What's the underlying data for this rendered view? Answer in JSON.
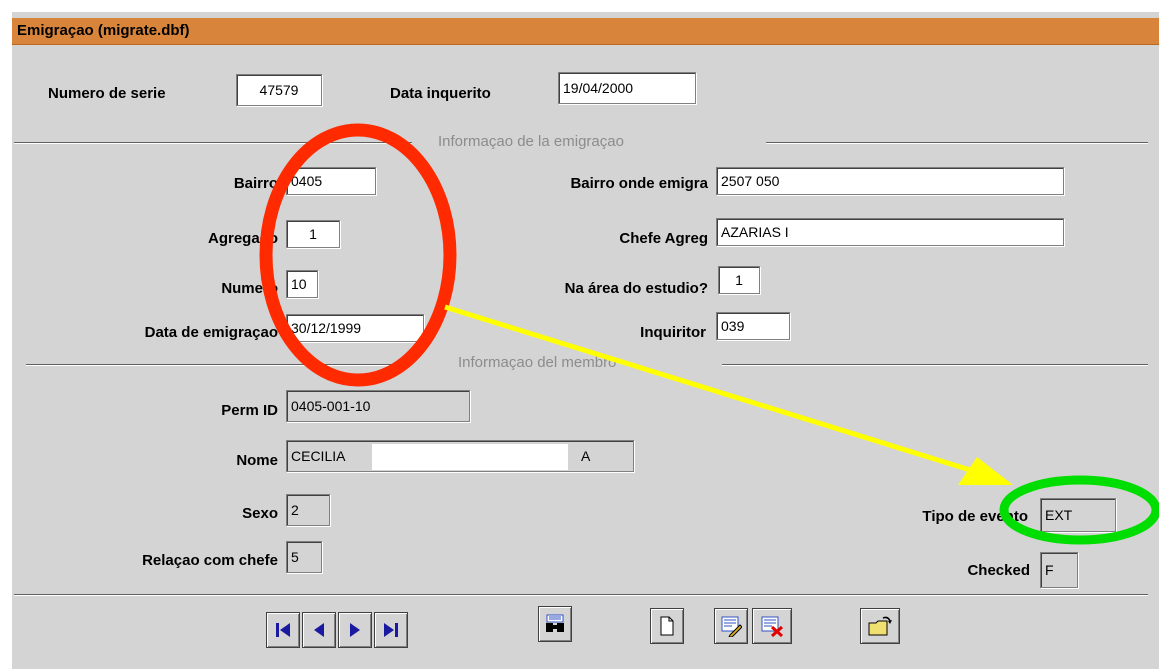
{
  "window": {
    "title": "Emigraçao (migrate.dbf)"
  },
  "header": {
    "numero_serie_label": "Numero de serie",
    "numero_serie_value": "47579",
    "data_inquerito_label": "Data inquerito",
    "data_inquerito_value": "19/04/2000"
  },
  "section_emigracao": {
    "title": "Informaçao de la emigraçao",
    "bairro_label": "Bairro",
    "bairro_value": "0405",
    "agregado_label": "Agregado",
    "agregado_value": "1",
    "numero_label": "Numero",
    "numero_value": "10",
    "data_emigracao_label": "Data de emigraçao",
    "data_emigracao_value": "30/12/1999",
    "bairro_onde_label": "Bairro onde emigra",
    "bairro_onde_value": "2507 050",
    "chefe_agreg_label": "Chefe Agreg",
    "chefe_agreg_value": "AZARIAS I",
    "na_area_label": "Na área do estudio?",
    "na_area_value": "1",
    "inquiritor_label": "Inquiritor",
    "inquiritor_value": "039"
  },
  "section_membro": {
    "title": "Informaçao del membro",
    "perm_id_label": "Perm ID",
    "perm_id_value": "0405-001-10",
    "nome_label": "Nome",
    "nome_value_left": "CECILIA",
    "nome_value_right": "A",
    "sexo_label": "Sexo",
    "sexo_value": "2",
    "relacao_label": "Relaçao com chefe",
    "relacao_value": "5",
    "tipo_evento_label": "Tipo de evento",
    "tipo_evento_value": "EXT",
    "checked_label": "Checked",
    "checked_value": "F"
  },
  "toolbar": {
    "buttons": [
      "first-record",
      "previous-record",
      "next-record",
      "last-record",
      "find-record",
      "new-record",
      "edit-record",
      "delete-record",
      "open-folder"
    ]
  },
  "annotations": {
    "red_ellipse_color": "#ff2a00",
    "arrow_color": "#ffff00",
    "green_ellipse_color": "#00dd00"
  }
}
